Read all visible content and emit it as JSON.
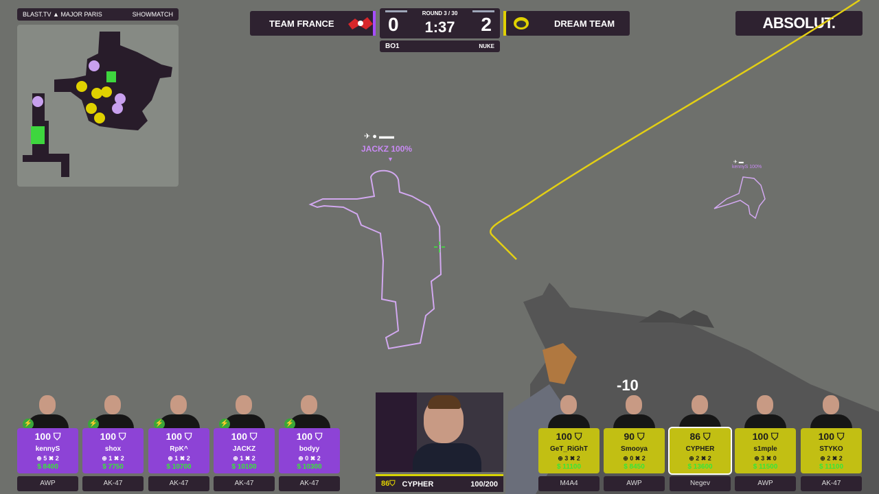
{
  "event": {
    "brand": "BLAST.TV",
    "title": "MAJOR PARIS",
    "label": "SHOWMATCH"
  },
  "scoreboard": {
    "left_team": "TEAM FRANCE",
    "right_team": "DREAM TEAM",
    "left_score": "0",
    "right_score": "2",
    "round": "ROUND 3 / 30",
    "timer": "1:37",
    "series": "BO1",
    "map": "NUKE"
  },
  "sponsor": "ABSOLUT.",
  "world": {
    "target_name": "JACKZ 100%",
    "far_name": "kennyS 100%",
    "damage": "-10"
  },
  "left_players": [
    {
      "name": "kennyS",
      "hp": "100",
      "kills": "5",
      "deaths": "2",
      "money": "$ 8400",
      "weapons": "AWP"
    },
    {
      "name": "shox",
      "hp": "100",
      "kills": "1",
      "deaths": "2",
      "money": "$ 7750",
      "weapons": "AK-47"
    },
    {
      "name": "RpK^",
      "hp": "100",
      "kills": "1",
      "deaths": "2",
      "money": "$ 10700",
      "weapons": "AK-47"
    },
    {
      "name": "JACKZ",
      "hp": "100",
      "kills": "1",
      "deaths": "2",
      "money": "$ 10100",
      "weapons": "AK-47"
    },
    {
      "name": "bodyy",
      "hp": "100",
      "kills": "0",
      "deaths": "2",
      "money": "$ 10300",
      "weapons": "AK-47"
    }
  ],
  "right_players": [
    {
      "name": "GeT_RiGhT",
      "hp": "100",
      "kills": "3",
      "deaths": "2",
      "money": "$ 11100",
      "weapons": "M4A4"
    },
    {
      "name": "Smooya",
      "hp": "90",
      "kills": "0",
      "deaths": "2",
      "money": "$ 8450",
      "weapons": "AWP"
    },
    {
      "name": "CYPHER",
      "hp": "86",
      "kills": "2",
      "deaths": "2",
      "money": "$ 13600",
      "weapons": "Negev"
    },
    {
      "name": "s1mple",
      "hp": "100",
      "kills": "3",
      "deaths": "0",
      "money": "$ 11500",
      "weapons": "AWP"
    },
    {
      "name": "STYKO",
      "hp": "100",
      "kills": "2",
      "deaths": "2",
      "money": "$ 11100",
      "weapons": "AK-47"
    }
  ],
  "pov": {
    "hp": "86",
    "name": "CYPHER",
    "ammo": "100/200"
  },
  "colors": {
    "t_team": "#8d43d6",
    "ct_team": "#c2bf13",
    "panel": "#2e2230",
    "money": "#39e639"
  }
}
